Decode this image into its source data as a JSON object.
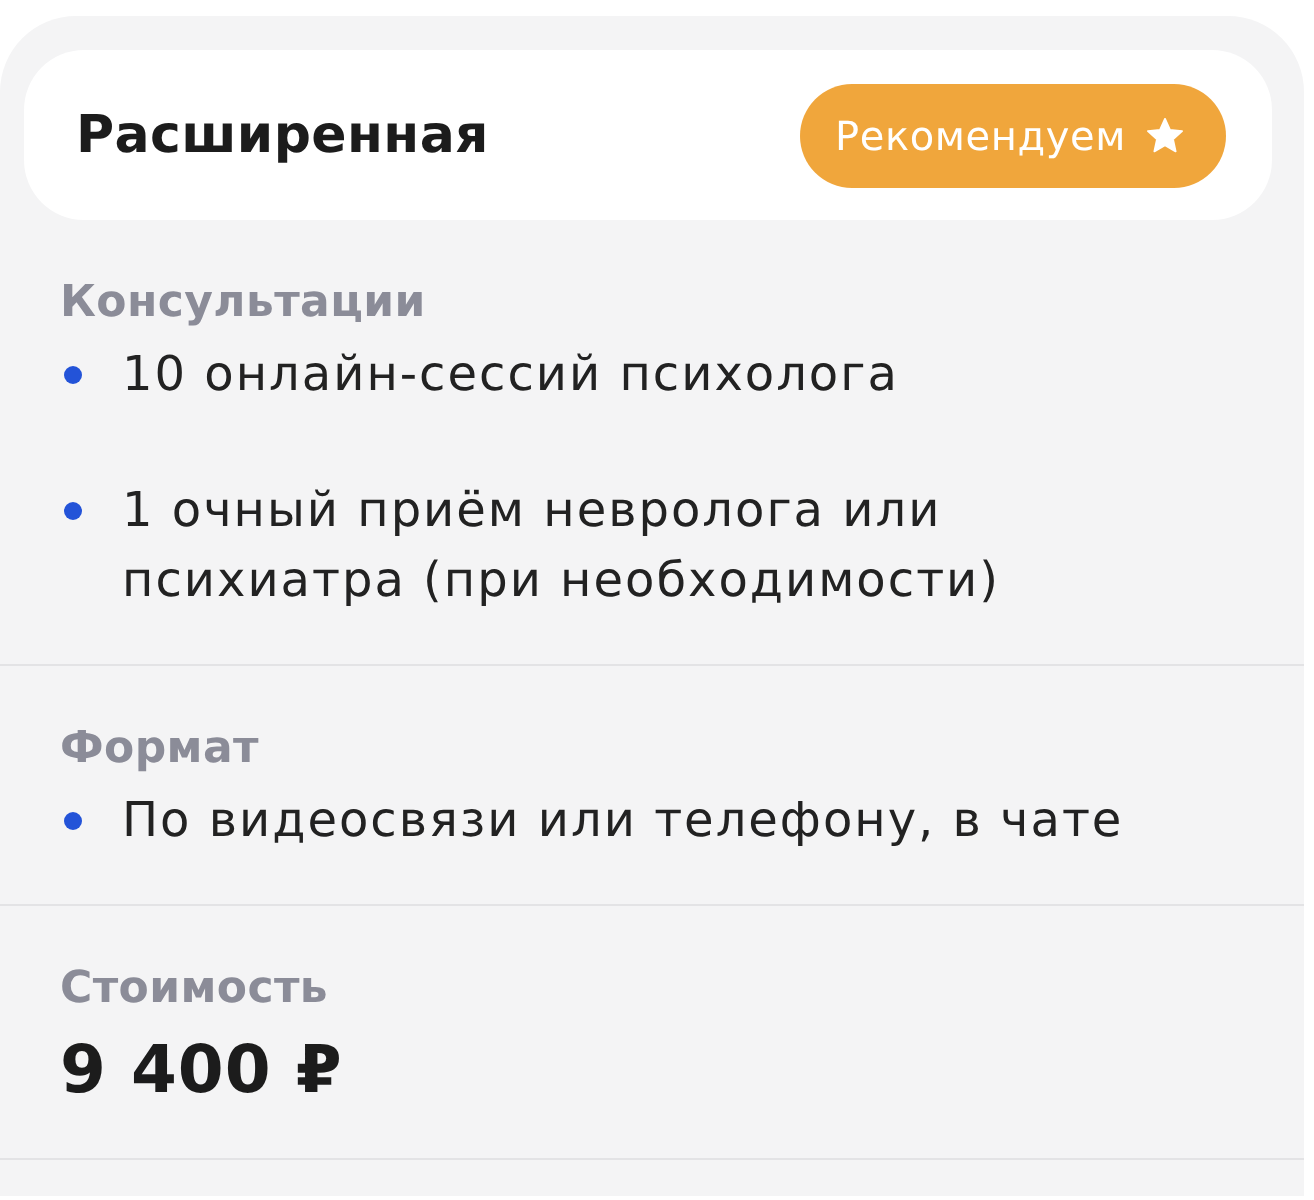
{
  "header": {
    "title": "Расширенная",
    "badge": {
      "label": "Рекомендуем",
      "star": true
    }
  },
  "sections": [
    {
      "kind": "list",
      "label": "Консультации",
      "items": [
        "10 онлайн-сессий психолога",
        "1 очный приём невролога или психиатра (при необходимости)"
      ]
    },
    {
      "kind": "list",
      "label": "Формат",
      "items": [
        "По видеосвязи или телефону, в чате"
      ]
    },
    {
      "kind": "price",
      "label": "Стоимость",
      "value": "9 400 ₽"
    }
  ]
}
